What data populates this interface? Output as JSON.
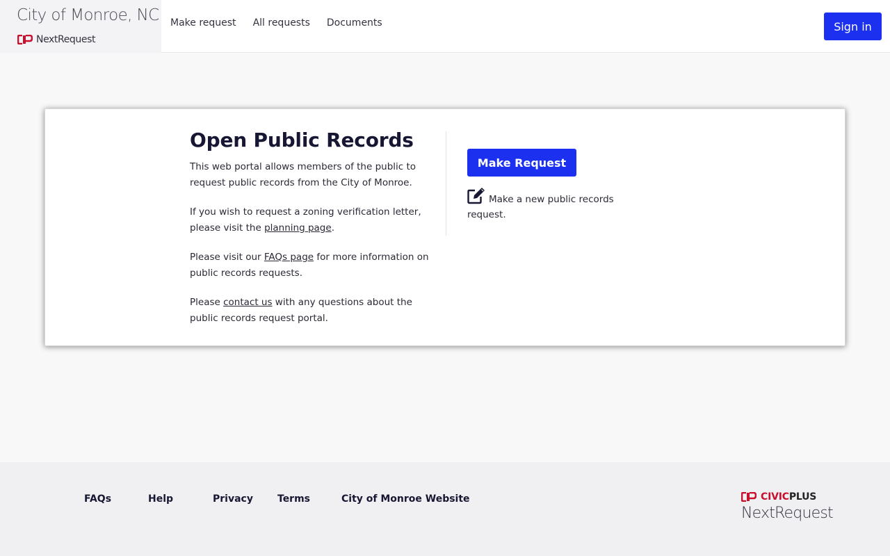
{
  "header": {
    "brand_title": "City of Monroe, NC",
    "brand_product": "NextRequest",
    "nav": [
      {
        "label": "Make request"
      },
      {
        "label": "All requests"
      },
      {
        "label": "Documents"
      }
    ],
    "signin_label": "Sign in"
  },
  "main": {
    "title": "Open Public Records",
    "intro": "This web portal allows members of the public to request public records from the City of Monroe.",
    "zoning": {
      "before": "If you wish to request a zoning verification letter, please visit the ",
      "link": "planning page",
      "after": "."
    },
    "faqs": {
      "before": "Please visit our ",
      "link": "FAQs page",
      "after": " for more information on public records requests."
    },
    "contact": {
      "before": "Please ",
      "link": "contact us",
      "after": " with any questions about the public records request portal."
    },
    "make_request_label": "Make Request",
    "make_request_desc": "Make a new public records request."
  },
  "footer": {
    "links": [
      {
        "label": "FAQs"
      },
      {
        "label": "Help"
      },
      {
        "label": "Privacy"
      },
      {
        "label": "Terms"
      },
      {
        "label": "City of Monroe Website"
      }
    ],
    "civic_brand_a": "CIVIC",
    "civic_brand_b": "PLUS",
    "civic_product": "NextRequest"
  },
  "colors": {
    "primary": "#1c31f0",
    "brand_red": "#c8102e",
    "heading": "#171733"
  },
  "icons": {
    "brand_mark": "civicplus-cp-logo-icon",
    "edit": "edit-pencil-square-icon"
  }
}
